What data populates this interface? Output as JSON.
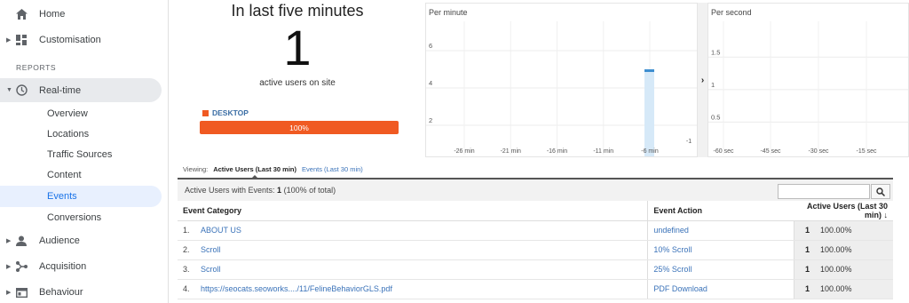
{
  "sidebar": {
    "home": "Home",
    "customisation": "Customisation",
    "section_reports": "REPORTS",
    "realtime": "Real-time",
    "realtime_items": [
      "Overview",
      "Locations",
      "Traffic Sources",
      "Content",
      "Events",
      "Conversions"
    ],
    "audience": "Audience",
    "acquisition": "Acquisition",
    "behaviour": "Behaviour"
  },
  "summary": {
    "title": "In last five minutes",
    "count": "1",
    "subtitle": "active users on site",
    "device_label": "DESKTOP",
    "device_percent": "100%",
    "device_fraction": 1.0
  },
  "chart_data": [
    {
      "type": "bar",
      "title": "Per minute",
      "x_tick_labels": [
        "-26 min",
        "-21 min",
        "-16 min",
        "-11 min",
        "-6 min",
        "-1"
      ],
      "y_tick_labels": [
        "2",
        "4",
        "6"
      ],
      "ylim": [
        0,
        7
      ],
      "x": [
        "-30 min",
        "-6 min"
      ],
      "values": [
        0,
        5
      ],
      "highlighted_minute": -6
    },
    {
      "type": "bar",
      "title": "Per second",
      "x_tick_labels": [
        "-60 sec",
        "-45 sec",
        "-30 sec",
        "-15 sec"
      ],
      "y_tick_labels": [
        "0.5",
        "1",
        "1.5"
      ],
      "ylim": [
        0,
        1.75
      ],
      "values": []
    }
  ],
  "viewing": {
    "label": "Viewing:",
    "tab_active": "Active Users (Last 30 min)",
    "tab_other": "Events (Last 30 min)"
  },
  "table": {
    "summary_prefix": "Active Users with Events:",
    "summary_value": "1",
    "summary_suffix": "(100% of total)",
    "headers": [
      "Event Category",
      "Event Action",
      "Active Users (Last 30 min)"
    ],
    "rows": [
      {
        "index": "1.",
        "category": "ABOUT US",
        "action": "undefined",
        "users": "1",
        "percent": "100.00%"
      },
      {
        "index": "2.",
        "category": "Scroll",
        "action": "10% Scroll",
        "users": "1",
        "percent": "100.00%"
      },
      {
        "index": "3.",
        "category": "Scroll",
        "action": "25% Scroll",
        "users": "1",
        "percent": "100.00%"
      },
      {
        "index": "4.",
        "category": "https://seocats.seoworks..../11/FelineBehaviorGLS.pdf",
        "action": "PDF Download",
        "users": "1",
        "percent": "100.00%"
      }
    ]
  },
  "colors": {
    "accent_orange": "#f05a22",
    "link_blue": "#3b73b9",
    "active_blue": "#1a73e8",
    "bar_light": "#d6e9f8",
    "bar_line": "#3e8ed0"
  },
  "icons": [
    "home-icon",
    "dashboard-icon",
    "clock-icon",
    "person-icon",
    "acquisition-icon",
    "behaviour-icon",
    "search-icon",
    "sort-down-icon",
    "chevron-right-icon"
  ]
}
